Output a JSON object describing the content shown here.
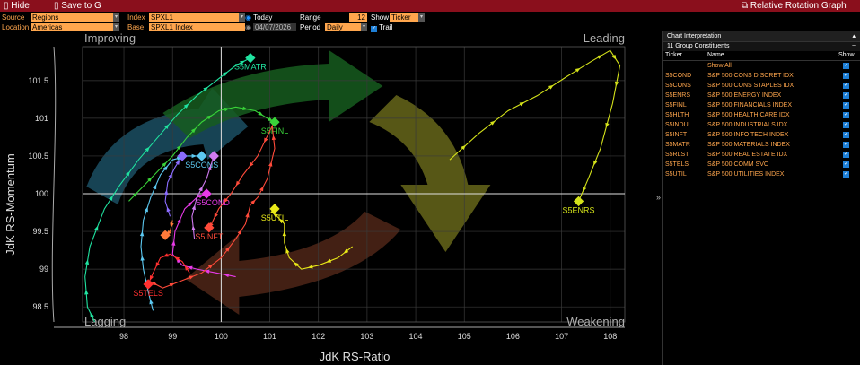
{
  "toolbar": {
    "hide_label": "Hide",
    "save_label": "Save to G",
    "title": "Relative Rotation Graph"
  },
  "controls": {
    "source_label": "Source",
    "source_value": "Regions",
    "location_label": "Location",
    "location_value": "Americas",
    "index_label": "Index",
    "index_value": "SPXL1",
    "base_label": "Base",
    "base_value": "SPXL1 Index",
    "today_label": "Today",
    "date_value": "04/07/2026",
    "range_label": "Range",
    "range_value": "12",
    "period_label": "Period",
    "period_value": "Daily",
    "show_label": "Show",
    "show_value": "Ticker",
    "trail_label": "Trail"
  },
  "side_panel": {
    "header": "Chart Interpretation",
    "subheader": "11 Group Constituents",
    "col_ticker": "Ticker",
    "col_name": "Name",
    "col_show": "Show",
    "show_all": "Show All",
    "rows": [
      {
        "ticker": "S5COND",
        "name": "S&P 500 CONS DISCRET IDX"
      },
      {
        "ticker": "S5CONS",
        "name": "S&P 500 CONS STAPLES IDX"
      },
      {
        "ticker": "S5ENRS",
        "name": "S&P 500 ENERGY INDEX"
      },
      {
        "ticker": "S5FINL",
        "name": "S&P 500 FINANCIALS INDEX"
      },
      {
        "ticker": "S5HLTH",
        "name": "S&P 500 HEALTH CARE IDX"
      },
      {
        "ticker": "S5INDU",
        "name": "S&P 500 INDUSTRIALS IDX"
      },
      {
        "ticker": "S5INFT",
        "name": "S&P 500 INFO TECH INDEX"
      },
      {
        "ticker": "S5MATR",
        "name": "S&P 500 MATERIALS INDEX"
      },
      {
        "ticker": "S5RLST",
        "name": "S&P 500 REAL ESTATE IDX"
      },
      {
        "ticker": "S5TELS",
        "name": "S&P 500 COMM SVC"
      },
      {
        "ticker": "S5UTIL",
        "name": "S&P 500 UTILITIES INDEX"
      }
    ]
  },
  "chart_data": {
    "type": "scatter",
    "xlabel": "JdK RS-Ratio",
    "ylabel": "JdK RS-Momentum",
    "xlim": [
      97.15,
      108.3
    ],
    "ylim": [
      98.3,
      101.95
    ],
    "x_ticks": [
      98,
      99,
      100,
      101,
      102,
      103,
      104,
      105,
      106,
      107,
      108
    ],
    "y_ticks": [
      98.5,
      99,
      99.5,
      100,
      100.5,
      101,
      101.5
    ],
    "quadrants": {
      "top_left": "Improving",
      "top_right": "Leading",
      "bottom_left": "Lagging",
      "bottom_right": "Weakening"
    },
    "series": [
      {
        "name": "S5MATR",
        "color": "#20e3a0",
        "label_pos": "below",
        "trail": [
          [
            97.4,
            98.3
          ],
          [
            97.25,
            98.5
          ],
          [
            97.2,
            98.9
          ],
          [
            97.3,
            99.3
          ],
          [
            97.6,
            99.8
          ],
          [
            97.9,
            100.1
          ],
          [
            98.3,
            100.45
          ],
          [
            98.7,
            100.75
          ],
          [
            99.1,
            101.05
          ],
          [
            99.5,
            101.3
          ],
          [
            99.9,
            101.5
          ],
          [
            100.3,
            101.7
          ],
          [
            100.6,
            101.8
          ]
        ]
      },
      {
        "name": "S5FINL",
        "color": "#39d339",
        "label_pos": "below",
        "trail": [
          [
            98.1,
            99.9
          ],
          [
            98.4,
            100.1
          ],
          [
            98.7,
            100.3
          ],
          [
            99.0,
            100.5
          ],
          [
            99.3,
            100.75
          ],
          [
            99.6,
            100.95
          ],
          [
            99.95,
            101.1
          ],
          [
            100.3,
            101.15
          ],
          [
            100.7,
            101.1
          ],
          [
            100.95,
            101.0
          ],
          [
            101.1,
            100.95
          ]
        ]
      },
      {
        "name": "S5ENRS",
        "color": "#d4e21a",
        "label_pos": "below",
        "trail": [
          [
            104.7,
            100.45
          ],
          [
            105.3,
            100.8
          ],
          [
            105.9,
            101.1
          ],
          [
            106.5,
            101.3
          ],
          [
            107.1,
            101.55
          ],
          [
            107.6,
            101.75
          ],
          [
            108.0,
            101.9
          ],
          [
            108.2,
            101.7
          ],
          [
            108.05,
            101.2
          ],
          [
            107.8,
            100.6
          ],
          [
            107.55,
            100.2
          ],
          [
            107.35,
            99.9
          ]
        ]
      },
      {
        "name": "S5UTIL",
        "color": "#e8e818",
        "label_pos": "below",
        "trail": [
          [
            102.7,
            99.3
          ],
          [
            102.4,
            99.15
          ],
          [
            102.0,
            99.05
          ],
          [
            101.65,
            99.0
          ],
          [
            101.4,
            99.15
          ],
          [
            101.3,
            99.35
          ],
          [
            101.3,
            99.6
          ],
          [
            101.15,
            99.7
          ],
          [
            101.05,
            99.75
          ],
          [
            101.1,
            99.8
          ]
        ]
      },
      {
        "name": "S5CONS",
        "color": "#5cc8f0",
        "label_pos": "below",
        "trail": [
          [
            98.6,
            98.45
          ],
          [
            98.5,
            98.7
          ],
          [
            98.4,
            99.0
          ],
          [
            98.35,
            99.3
          ],
          [
            98.4,
            99.65
          ],
          [
            98.55,
            99.95
          ],
          [
            98.75,
            100.25
          ],
          [
            99.0,
            100.45
          ],
          [
            99.3,
            100.5
          ],
          [
            99.6,
            100.5
          ]
        ]
      },
      {
        "name": "S5COND",
        "color": "#e83ae8",
        "label_pos": "right",
        "trail": [
          [
            100.3,
            98.9
          ],
          [
            99.9,
            98.95
          ],
          [
            99.5,
            99.0
          ],
          [
            99.2,
            99.05
          ],
          [
            99.0,
            99.2
          ],
          [
            99.05,
            99.5
          ],
          [
            99.25,
            99.8
          ],
          [
            99.5,
            99.95
          ],
          [
            99.7,
            100.0
          ]
        ]
      },
      {
        "name": "S5HLTH",
        "color": "#8b6cff",
        "label_pos": "none",
        "trail": [
          [
            98.95,
            99.7
          ],
          [
            98.85,
            99.9
          ],
          [
            98.9,
            100.15
          ],
          [
            99.05,
            100.35
          ],
          [
            99.2,
            100.5
          ]
        ]
      },
      {
        "name": "S5INDU",
        "color": "#d07af0",
        "label_pos": "none",
        "trail": [
          [
            99.45,
            99.4
          ],
          [
            99.4,
            99.7
          ],
          [
            99.5,
            99.95
          ],
          [
            99.7,
            100.2
          ],
          [
            99.85,
            100.5
          ]
        ]
      },
      {
        "name": "S5INFT",
        "color": "#ff4a3a",
        "label_pos": "below",
        "trail": [
          [
            98.5,
            98.85
          ],
          [
            98.8,
            98.75
          ],
          [
            99.2,
            98.85
          ],
          [
            99.6,
            98.95
          ],
          [
            100.0,
            99.15
          ],
          [
            100.3,
            99.4
          ],
          [
            100.5,
            99.6
          ],
          [
            100.6,
            99.85
          ],
          [
            100.75,
            99.95
          ],
          [
            100.95,
            100.2
          ],
          [
            101.1,
            100.6
          ],
          [
            101.05,
            100.9
          ],
          [
            100.75,
            100.5
          ],
          [
            100.45,
            100.25
          ],
          [
            100.2,
            100.0
          ],
          [
            99.95,
            99.8
          ],
          [
            99.8,
            99.6
          ],
          [
            99.75,
            99.55
          ]
        ]
      },
      {
        "name": "S5RLST",
        "color": "#ff7a3a",
        "label_pos": "none",
        "trail": [
          [
            99.0,
            99.65
          ],
          [
            98.95,
            99.5
          ],
          [
            98.85,
            99.45
          ]
        ]
      },
      {
        "name": "S5TELS",
        "color": "#ff3030",
        "label_pos": "below",
        "trail": [
          [
            99.35,
            98.95
          ],
          [
            99.2,
            99.1
          ],
          [
            98.95,
            99.2
          ],
          [
            98.75,
            99.15
          ],
          [
            98.6,
            98.95
          ],
          [
            98.5,
            98.8
          ]
        ]
      }
    ]
  }
}
